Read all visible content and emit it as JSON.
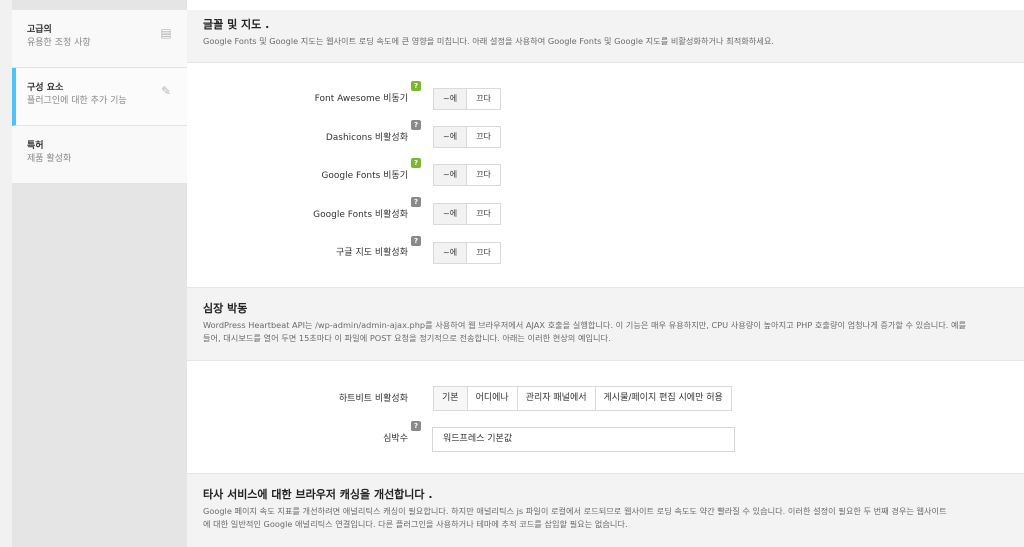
{
  "sidebar": {
    "items": [
      {
        "title": "고급의",
        "subtitle": "유용한 조정 사항",
        "icon": "list-icon"
      },
      {
        "title": "구성 요소",
        "subtitle": "플러그인에 대한 추가 기능",
        "icon": "plugin-icon"
      },
      {
        "title": "특허",
        "subtitle": "제품 활성화"
      }
    ]
  },
  "sections": {
    "fonts": {
      "title": "글꼴 및 지도 .",
      "desc": "Google Fonts 및 Google 지도는 웹사이트 로딩 속도에 큰 영향을 미칩니다. 아래 설정을 사용하여 Google Fonts 및 Google 지도를 비활성화하거나 최적화하세요."
    },
    "heartbeat": {
      "title": "심장 박동",
      "desc1": "WordPress Heartbeat API는 /wp-admin/admin-ajax.php를 사용하여 웹 브라우저에서 AJAX 호출을 실행합니다. 이 기능은 매우 유용하지만, CPU 사용량이 높아지고 PHP 호출량이 엄청나게 증가할 수 있습니다. 예를",
      "desc2": "들어, 대시보드를 열어 두면 15초마다 이 파일에 POST 요청을 정기적으로 전송합니다. 아래는 이러한 현상의 예입니다."
    },
    "caching": {
      "title": "타사 서비스에 대한 브라우저 캐싱을 개선합니다 .",
      "desc1": "Google 페이지 속도 지표를 개선하려면 애널리틱스 캐싱이 필요합니다. 하지만 애널리틱스 js 파일이 로컬에서 로드되므로 웹사이트 로딩 속도도 약간 빨라질 수 있습니다. 이러한 설정이 필요한 두 번째 경우는 웹사이트",
      "desc2": "에 대한 일반적인 Google 애널리틱스 연결입니다. 다른 플러그인을 사용하거나 테마에 추적 코드를 삽입할 필요는 없습니다."
    }
  },
  "settings": [
    {
      "label": "Font Awesome 비동기",
      "on": "~에",
      "off": "끄다",
      "help": "?",
      "help_color": "#7cb82f"
    },
    {
      "label": "Dashicons 비활성화",
      "on": "~에",
      "off": "끄다",
      "help": "?",
      "help_color": "#8a8a8a"
    },
    {
      "label": "Google Fonts 비동기",
      "on": "~에",
      "off": "끄다",
      "help": "?",
      "help_color": "#7cb82f"
    },
    {
      "label": "Google Fonts 비활성화",
      "on": "~에",
      "off": "끄다",
      "help": "?",
      "help_color": "#8a8a8a"
    },
    {
      "label": "구글 지도 비활성화",
      "on": "~에",
      "off": "끄다",
      "help": "?",
      "help_color": "#8a8a8a"
    }
  ],
  "heartbeat_disable": {
    "label": "하트비트 비활성화",
    "options": [
      "기본",
      "어디에나",
      "관리자 패널에서",
      "게시물/페이지 편집 시에만 허용"
    ]
  },
  "heartbeat_frequency": {
    "label": "심박수",
    "help": "?",
    "value": "워드프레스 기본값"
  }
}
